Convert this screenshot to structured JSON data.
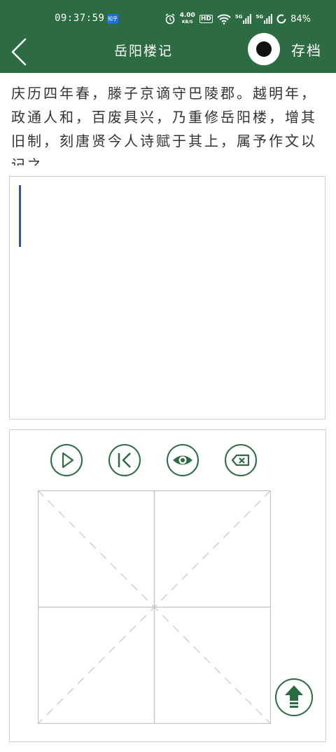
{
  "status_bar": {
    "time": "09:37:59",
    "app_badge": "知乎",
    "net_speed": "4.00",
    "net_unit": "KB/S",
    "hd_label": "HD",
    "sig1_label": "5G",
    "sig2_label": "5G",
    "battery": "84%"
  },
  "header": {
    "title": "岳阳楼记",
    "save_label": "存档"
  },
  "passage": {
    "text": "庆历四年春，滕子京谪守巴陵郡。越明年，政通人和，百废具兴，乃重修岳阳楼，增其旧制，刻唐贤今人诗赋于其上，属予作文以记之。"
  },
  "controls": {
    "play": "play-icon",
    "restart": "skip-back-icon",
    "preview": "eye-icon",
    "delete": "backspace-icon",
    "upload": "upload-icon"
  },
  "colors": {
    "primary": "#2d6b42",
    "cursor": "#2a57a6",
    "border": "#cfcfcf",
    "text": "#333333"
  }
}
